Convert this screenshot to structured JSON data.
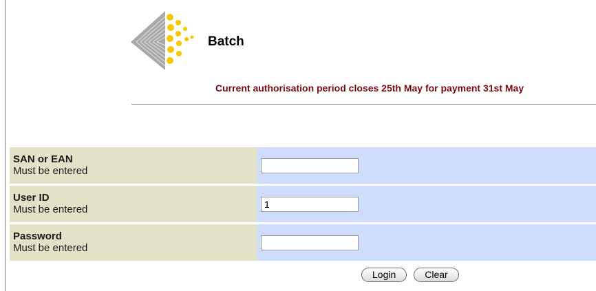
{
  "header": {
    "title": "Batch",
    "notice": "Current authorisation period closes 25th May for payment 31st May"
  },
  "form": {
    "fields": [
      {
        "label": "SAN or EAN",
        "hint": "Must be entered",
        "value": ""
      },
      {
        "label": "User ID",
        "hint": "Must be entered",
        "value": "1"
      },
      {
        "label": "Password",
        "hint": "Must be entered",
        "value": ""
      }
    ]
  },
  "buttons": {
    "login": "Login",
    "clear": "Clear"
  },
  "colors": {
    "label_bg": "#e3e2c6",
    "input_bg": "#cdddfb",
    "notice_text": "#7a0b14",
    "logo_yellow": "#f5c800",
    "logo_grey": "#9a9a9a"
  }
}
